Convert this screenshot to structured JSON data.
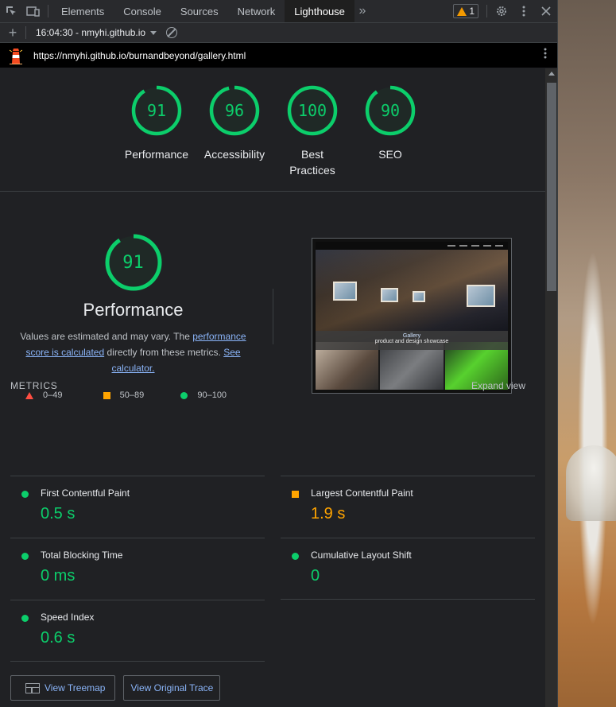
{
  "devtools": {
    "tabs": [
      {
        "label": "Elements"
      },
      {
        "label": "Console"
      },
      {
        "label": "Sources"
      },
      {
        "label": "Network"
      },
      {
        "label": "Lighthouse",
        "active": true
      }
    ],
    "warning_count": "1",
    "report_selector": "16:04:30 - nmyhi.github.io"
  },
  "report": {
    "url": "https://nmyhi.github.io/burnandbeyond/gallery.html",
    "gauges": [
      {
        "score": "91",
        "label": "Performance"
      },
      {
        "score": "96",
        "label": "Accessibility"
      },
      {
        "score": "100",
        "label": "Best Practices"
      },
      {
        "score": "90",
        "label": "SEO"
      }
    ],
    "performance": {
      "score": "91",
      "title": "Performance",
      "desc_prefix": "Values are estimated and may vary. The ",
      "desc_link1": "performance score is calculated",
      "desc_middle": " directly from these metrics. ",
      "desc_link2": "See calculator.",
      "legend": [
        {
          "range": "0–49"
        },
        {
          "range": "50–89"
        },
        {
          "range": "90–100"
        }
      ]
    },
    "screenshot": {
      "banner_title": "Gallery",
      "banner_subtitle": "product and design showcase"
    },
    "metrics": {
      "header": "METRICS",
      "expand": "Expand view",
      "items": [
        {
          "title": "First Contentful Paint",
          "value": "0.5 s",
          "rating": "pass"
        },
        {
          "title": "Largest Contentful Paint",
          "value": "1.9 s",
          "rating": "average"
        },
        {
          "title": "Total Blocking Time",
          "value": "0 ms",
          "rating": "pass"
        },
        {
          "title": "Cumulative Layout Shift",
          "value": "0",
          "rating": "pass"
        },
        {
          "title": "Speed Index",
          "value": "0.6 s",
          "rating": "pass"
        }
      ]
    },
    "buttons": {
      "treemap": "View Treemap",
      "trace": "View Original Trace"
    }
  },
  "colors": {
    "pass": "#0cce6b",
    "average": "#ffa400",
    "fail": "#ff4e42",
    "link": "#8ab4f8"
  }
}
